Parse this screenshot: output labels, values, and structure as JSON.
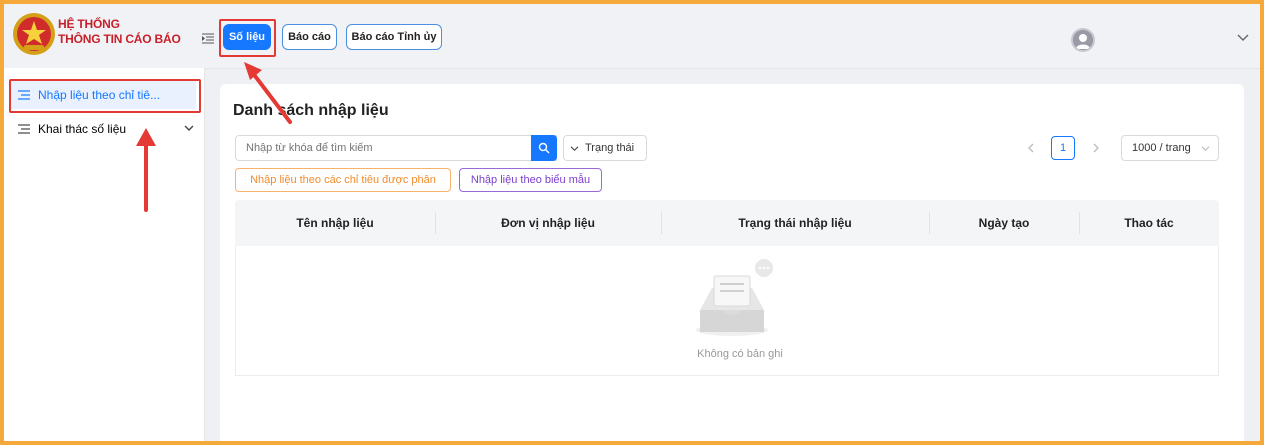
{
  "brand": {
    "line1": "HỆ THỐNG",
    "line2": "THÔNG TIN CÁO BÁO"
  },
  "top_tabs": [
    {
      "label": "Số liệu",
      "active": true
    },
    {
      "label": "Báo cáo",
      "active": false
    },
    {
      "label": "Báo cáo Tỉnh ủy",
      "active": false
    }
  ],
  "sidebar": {
    "items": [
      {
        "label": "Nhập liệu theo chỉ tiê...",
        "active": true
      },
      {
        "label": "Khai thác số liệu",
        "active": false
      }
    ]
  },
  "main": {
    "title": "Danh sách nhập liệu",
    "search_placeholder": "Nhập từ khóa để tìm kiếm",
    "status_filter": "Trạng thái",
    "filter_pills": [
      "Nhập liệu theo các chỉ tiêu được phân",
      "Nhập liệu theo biểu mẫu"
    ],
    "pagination": {
      "current_page": "1",
      "page_size": "1000 / trang"
    },
    "table": {
      "columns": [
        "Tên nhập liệu",
        "Đơn vị nhập liệu",
        "Trạng thái nhập liệu",
        "Ngày tạo",
        "Thao tác"
      ],
      "empty_text": "Không có bản ghi"
    }
  },
  "colors": {
    "accent": "#1677ff",
    "brand_red": "#c8202a",
    "frame_border": "#f5a93a",
    "annotation_red": "#e53935",
    "pill_orange": "#f08c2a",
    "pill_purple": "#7b3fc9"
  },
  "icons": [
    "menu-fold-icon",
    "search-icon",
    "chevron-down-icon",
    "user-avatar-icon",
    "list-icon",
    "empty-inbox-icon",
    "chevron-left-icon",
    "chevron-right-icon"
  ]
}
